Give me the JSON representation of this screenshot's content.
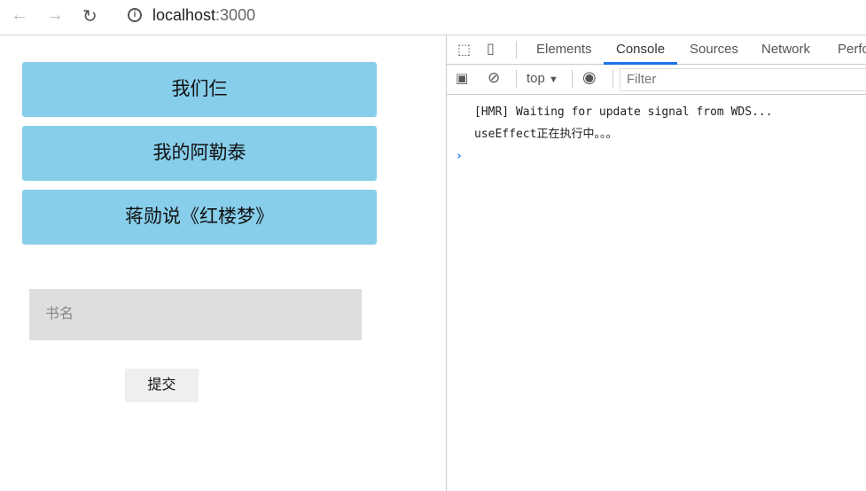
{
  "browser": {
    "url_host": "localhost",
    "url_port": ":3000"
  },
  "page": {
    "books": [
      "我们仨",
      "我的阿勒泰",
      "蒋勋说《红楼梦》"
    ],
    "input_placeholder": "书名",
    "submit_label": "提交"
  },
  "devtools": {
    "tabs": [
      "Elements",
      "Console",
      "Sources",
      "Network",
      "Perfo"
    ],
    "active_tab": "Console",
    "context": "top",
    "filter_placeholder": "Filter",
    "logs": [
      "[HMR] Waiting for update signal from WDS...",
      "useEffect正在执行中。。。"
    ],
    "prompt": "›"
  }
}
